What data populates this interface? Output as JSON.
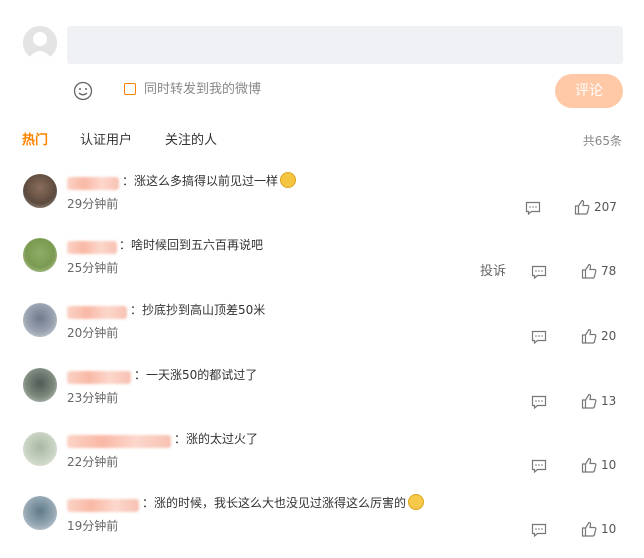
{
  "composer": {
    "repost_label": "同时转发到我的微博",
    "comment_button": "评论"
  },
  "tabs": [
    {
      "label": "热门",
      "active": true
    },
    {
      "label": "认证用户",
      "active": false
    },
    {
      "label": "关注的人",
      "active": false
    }
  ],
  "total_label": "共65条",
  "comments": [
    {
      "text": "涨这么多搞得以前见过一样",
      "sticker": "doge-icon",
      "time": "29分钟前",
      "likes": "207"
    },
    {
      "text": "啥时候回到五六百再说吧",
      "time": "25分钟前",
      "likes": "78",
      "report": "投诉"
    },
    {
      "text": "抄底抄到高山顶差50米",
      "time": "20分钟前",
      "likes": "20"
    },
    {
      "text": "一天涨50的都试过了",
      "time": "23分钟前",
      "likes": "13"
    },
    {
      "text": "涨的太过火了",
      "time": "22分钟前",
      "likes": "10"
    },
    {
      "text": "涨的时候，我长这么大也没见过涨得这么厉害的",
      "sticker": "sweat-smile-icon",
      "time": "19分钟前",
      "likes": "10"
    }
  ],
  "colors": {
    "accent": "#ff8200",
    "button": "#ffc8a6"
  }
}
